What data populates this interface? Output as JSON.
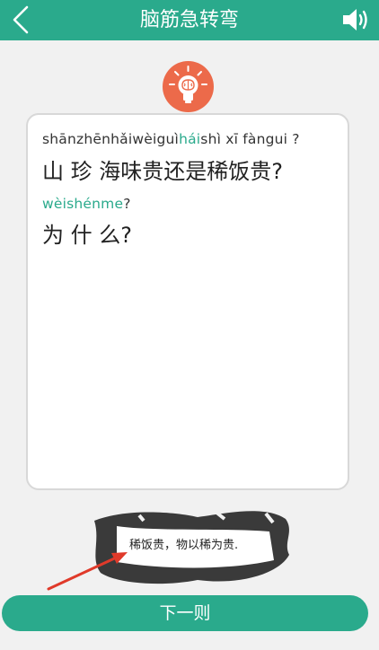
{
  "header": {
    "title": "脑筋急转弯",
    "back_icon": "chevron-left-icon",
    "sound_icon": "speaker-volume-icon"
  },
  "hint_icon": "lightbulb-brain-icon",
  "question": {
    "line1_pinyin_before": "shānzhēnhǎiwèiguì",
    "line1_pinyin_highlight": "hái",
    "line1_pinyin_after": "shì xī fàngui ?",
    "line1_hanzi": "山 珍 海味贵还是稀饭贵?",
    "line2_pinyin": "wèishénme",
    "line2_pinyin_after": "?",
    "line2_hanzi": "为 什 么?"
  },
  "answer": {
    "text": "稀饭贵，物以稀为贵."
  },
  "next_button": {
    "label": "下一则"
  },
  "colors": {
    "accent": "#2aaa8c",
    "bulb": "#ec6a4a",
    "arrow": "#e03a2a"
  }
}
